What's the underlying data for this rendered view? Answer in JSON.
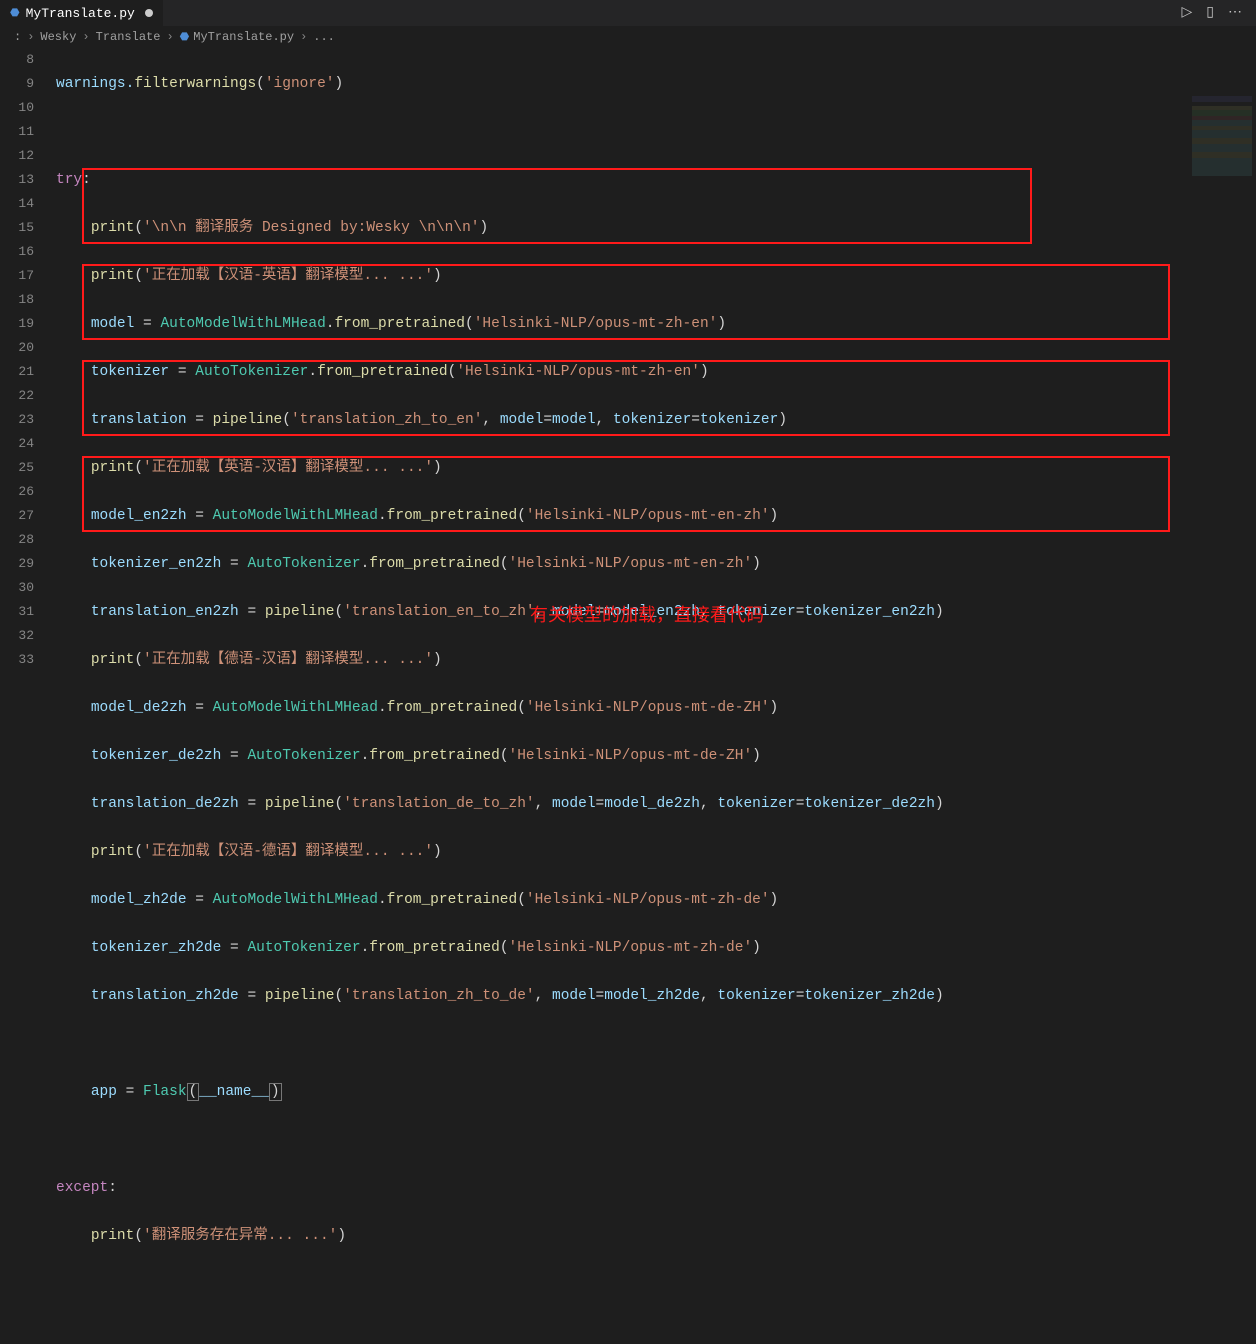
{
  "tab": {
    "filename": "MyTranslate.py"
  },
  "topIcons": {
    "run": "▷",
    "split": "▯",
    "more": "⋯"
  },
  "breadcrumb": {
    "items": [
      ":",
      "Wesky",
      "Translate",
      "MyTranslate.py",
      "..."
    ]
  },
  "lines": {
    "start": 8,
    "end": 33
  },
  "code": {
    "l8": {
      "a": "warnings.",
      "b": "filterwarnings",
      "c": "(",
      "d": "'ignore'",
      "e": ")"
    },
    "l10": {
      "kw": "try",
      "colon": ":"
    },
    "l11": {
      "fn": "print",
      "p1": "(",
      "s": "'\\n\\n 翻译服务 Designed by:Wesky \\n\\n\\n'",
      "p2": ")"
    },
    "l12": {
      "fn": "print",
      "p1": "(",
      "s": "'正在加载【汉语-英语】翻译模型... ...'",
      "p2": ")"
    },
    "l13": {
      "v": "model",
      "eq": " = ",
      "cls": "AutoModelWithLMHead",
      "dot": ".",
      "m": "from_pretrained",
      "p1": "(",
      "s": "'Helsinki-NLP/opus-mt-zh-en'",
      "p2": ")"
    },
    "l14": {
      "v": "tokenizer",
      "eq": " = ",
      "cls": "AutoTokenizer",
      "dot": ".",
      "m": "from_pretrained",
      "p1": "(",
      "s": "'Helsinki-NLP/opus-mt-zh-en'",
      "p2": ")"
    },
    "l15": {
      "v": "translation",
      "eq": " = ",
      "fn": "pipeline",
      "p1": "(",
      "s": "'translation_zh_to_en'",
      "c1": ", ",
      "k1": "model",
      "eq2": "=",
      "v1": "model",
      "c2": ", ",
      "k2": "tokenizer",
      "eq3": "=",
      "v2": "tokenizer",
      "p2": ")"
    },
    "l16": {
      "fn": "print",
      "p1": "(",
      "s": "'正在加载【英语-汉语】翻译模型... ...'",
      "p2": ")"
    },
    "l17": {
      "v": "model_en2zh",
      "eq": " = ",
      "cls": "AutoModelWithLMHead",
      "dot": ".",
      "m": "from_pretrained",
      "p1": "(",
      "s": "'Helsinki-NLP/opus-mt-en-zh'",
      "p2": ")"
    },
    "l18": {
      "v": "tokenizer_en2zh",
      "eq": " = ",
      "cls": "AutoTokenizer",
      "dot": ".",
      "m": "from_pretrained",
      "p1": "(",
      "s": "'Helsinki-NLP/opus-mt-en-zh'",
      "p2": ")"
    },
    "l19": {
      "v": "translation_en2zh",
      "eq": " = ",
      "fn": "pipeline",
      "p1": "(",
      "s": "'translation_en_to_zh'",
      "c1": ", ",
      "k1": "model",
      "eq2": "=",
      "v1": "model_en2zh",
      "c2": ", ",
      "k2": "tokenizer",
      "eq3": "=",
      "v2": "tokenizer_en2zh",
      "p2": ")"
    },
    "l20": {
      "fn": "print",
      "p1": "(",
      "s": "'正在加载【德语-汉语】翻译模型... ...'",
      "p2": ")"
    },
    "l21": {
      "v": "model_de2zh",
      "eq": " = ",
      "cls": "AutoModelWithLMHead",
      "dot": ".",
      "m": "from_pretrained",
      "p1": "(",
      "s": "'Helsinki-NLP/opus-mt-de-ZH'",
      "p2": ")"
    },
    "l22": {
      "v": "tokenizer_de2zh",
      "eq": " = ",
      "cls": "AutoTokenizer",
      "dot": ".",
      "m": "from_pretrained",
      "p1": "(",
      "s": "'Helsinki-NLP/opus-mt-de-ZH'",
      "p2": ")"
    },
    "l23": {
      "v": "translation_de2zh",
      "eq": " = ",
      "fn": "pipeline",
      "p1": "(",
      "s": "'translation_de_to_zh'",
      "c1": ", ",
      "k1": "model",
      "eq2": "=",
      "v1": "model_de2zh",
      "c2": ", ",
      "k2": "tokenizer",
      "eq3": "=",
      "v2": "tokenizer_de2zh",
      "p2": ")"
    },
    "l24": {
      "fn": "print",
      "p1": "(",
      "s": "'正在加载【汉语-德语】翻译模型... ...'",
      "p2": ")"
    },
    "l25": {
      "v": "model_zh2de",
      "eq": " = ",
      "cls": "AutoModelWithLMHead",
      "dot": ".",
      "m": "from_pretrained",
      "p1": "(",
      "s": "'Helsinki-NLP/opus-mt-zh-de'",
      "p2": ")"
    },
    "l26": {
      "v": "tokenizer_zh2de",
      "eq": " = ",
      "cls": "AutoTokenizer",
      "dot": ".",
      "m": "from_pretrained",
      "p1": "(",
      "s": "'Helsinki-NLP/opus-mt-zh-de'",
      "p2": ")"
    },
    "l27": {
      "v": "translation_zh2de",
      "eq": " = ",
      "fn": "pipeline",
      "p1": "(",
      "s": "'translation_zh_to_de'",
      "c1": ", ",
      "k1": "model",
      "eq2": "=",
      "v1": "model_zh2de",
      "c2": ", ",
      "k2": "tokenizer",
      "eq3": "=",
      "v2": "tokenizer_zh2de",
      "p2": ")"
    },
    "l29": {
      "v": "app",
      "eq": " = ",
      "cls": "Flask",
      "p1": "(",
      "arg": "__name__",
      "p2": ")"
    },
    "l31": {
      "kw": "except",
      "colon": ":"
    },
    "l32": {
      "fn": "print",
      "p1": "(",
      "s": "'翻译服务存在异常... ...'",
      "p2": ")"
    }
  },
  "annotation": "有关模型的加载，直接看代码"
}
